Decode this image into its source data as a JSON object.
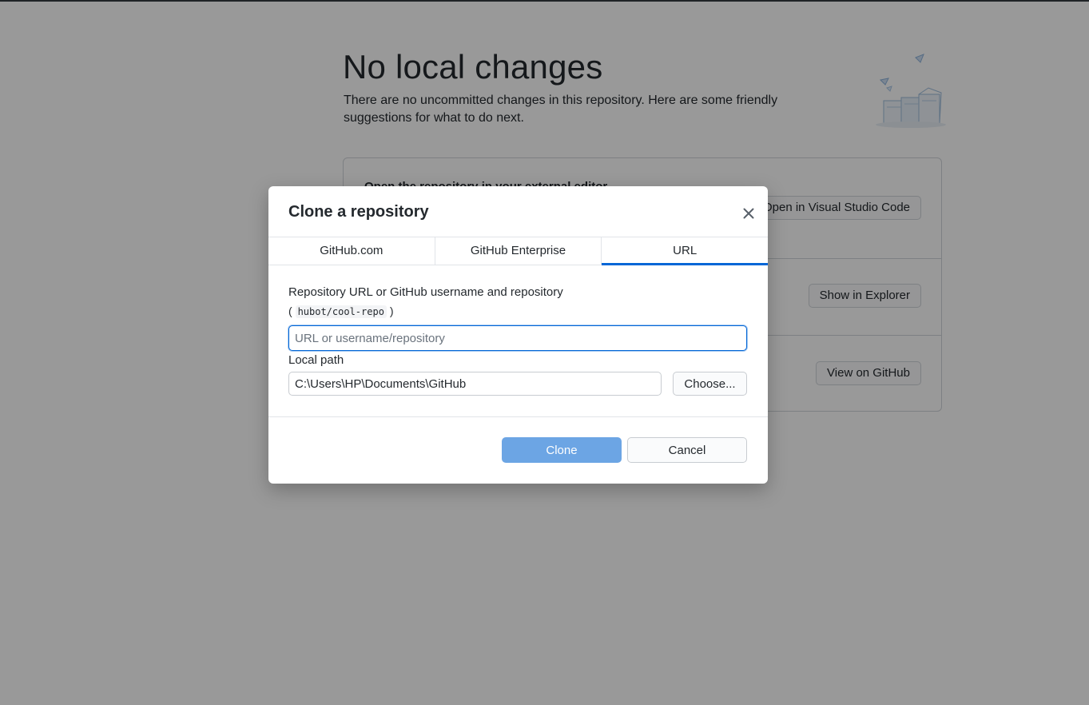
{
  "background": {
    "title": "No local changes",
    "description": "There are no uncommitted changes in this repository. Here are some friendly suggestions for what to do next.",
    "suggestions": [
      {
        "title": "Open the repository in your external editor",
        "button": "Open in Visual Studio Code"
      },
      {
        "title": "",
        "button": "Show in Explorer"
      },
      {
        "title": "",
        "button": "View on GitHub"
      }
    ]
  },
  "dialog": {
    "title": "Clone a repository",
    "close_icon": "close-icon",
    "tabs": [
      {
        "label": "GitHub.com",
        "active": false
      },
      {
        "label": "GitHub Enterprise",
        "active": false
      },
      {
        "label": "URL",
        "active": true
      }
    ],
    "url_label": "Repository URL or GitHub username and repository",
    "url_hint_open": "(",
    "url_hint_code": "hubot/cool-repo",
    "url_hint_close": ")",
    "url_value": "",
    "url_placeholder": "URL or username/repository",
    "path_label": "Local path",
    "path_value": "C:\\Users\\HP\\Documents\\GitHub",
    "choose_label": "Choose...",
    "clone_label": "Clone",
    "cancel_label": "Cancel"
  },
  "colors": {
    "accent": "#0366d6",
    "clone_button_disabled": "#6ca5e4",
    "overlay": "rgba(0,0,0,0.40)"
  }
}
